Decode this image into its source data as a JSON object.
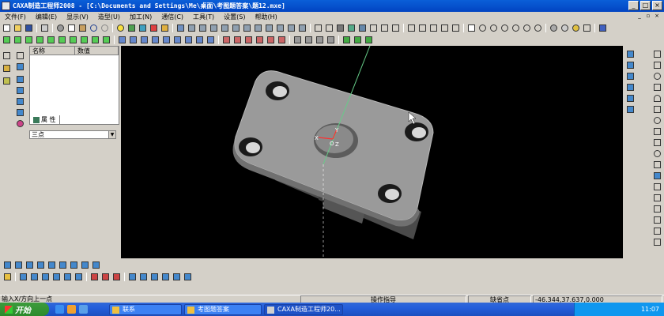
{
  "window": {
    "title": "CAXA制造工程师2008 - [C:\\Documents and Settings\\Me\\桌面\\考图题答案\\题12.mxe]"
  },
  "menu": [
    "文件(F)",
    "编辑(E)",
    "显示(V)",
    "造型(U)",
    "加工(N)",
    "通信(C)",
    "工具(T)",
    "设置(S)",
    "帮助(H)"
  ],
  "tree_panel": {
    "columns": [
      "名称",
      "数值"
    ],
    "tab_label": "属 性"
  },
  "point_mode": {
    "selected": "三点"
  },
  "viewport": {
    "axis_labels": {
      "y": "Y",
      "x": "X",
      "o": "O",
      "z": "Z"
    }
  },
  "statusbar": {
    "prompt": "输入X/方向上一点",
    "hint": "操作指导",
    "snap": "缺省点",
    "coords": "-46.344,37.637,0.000"
  },
  "taskbar": {
    "start_label": "开始",
    "tasks": [
      "联系",
      "考图题答案",
      "CAXA制造工程师20..."
    ],
    "clock": "11:07"
  },
  "colors": {
    "background": "#000000",
    "model": "#9a9a9a",
    "axis": "#66cc88",
    "titlebar": "#0a5fd8"
  }
}
